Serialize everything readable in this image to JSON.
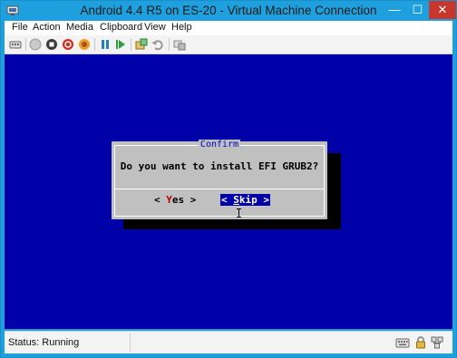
{
  "window": {
    "title": "Android 4.4 R5 on ES-20 - Virtual Machine Connection",
    "minimize_glyph": "—",
    "maximize_glyph": "☐",
    "close_glyph": "✕"
  },
  "menu": {
    "items": [
      "File",
      "Action",
      "Media",
      "Clipboard",
      "View",
      "Help"
    ]
  },
  "toolbar": {
    "icons": [
      "ctrl-alt-del-icon",
      "start-icon",
      "turn-off-icon",
      "shut-down-icon",
      "save-icon",
      "pause-icon",
      "reset-icon",
      "checkpoint-icon",
      "revert-icon",
      "enhanced-session-icon"
    ]
  },
  "dialog": {
    "title": "Confirm",
    "message": "Do you want to install EFI GRUB2?",
    "yes": {
      "left": "< ",
      "hotkey": "Y",
      "rest": "es",
      "right": " >"
    },
    "skip": {
      "left": "< ",
      "hotkey": "S",
      "rest": "kip",
      "right": " >"
    }
  },
  "status": {
    "text": "Status: Running",
    "icons": [
      "keyboard-icon",
      "lock-icon",
      "network-icon"
    ]
  },
  "colors": {
    "titlebar": "#1ea0df",
    "close_button": "#c7372e",
    "screen_background": "#0000a8",
    "dialog_background": "#c0c0c0",
    "dialog_title": "#0000c8",
    "hotkey": "#b40000"
  }
}
